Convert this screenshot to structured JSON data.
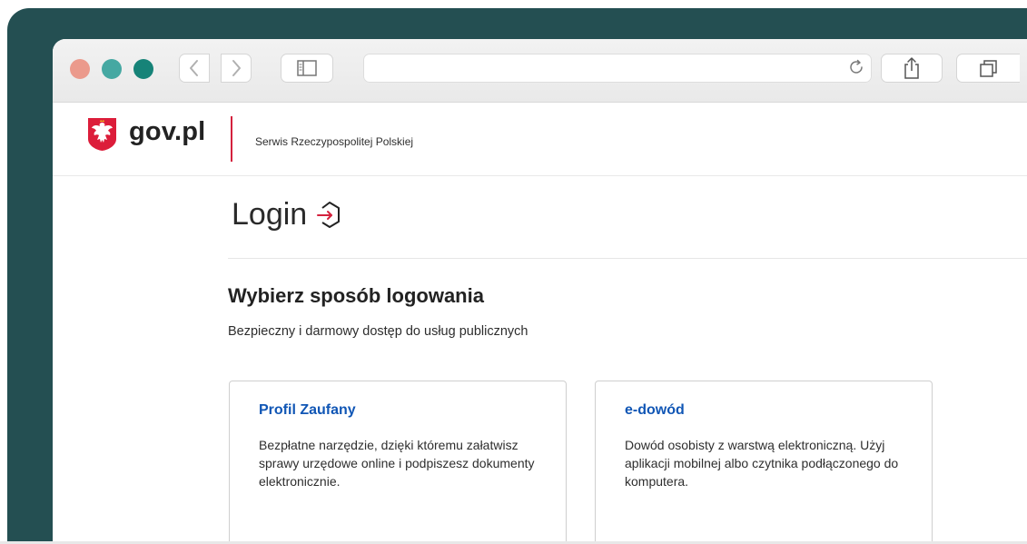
{
  "brand": {
    "name": "gov.pl",
    "service": "Serwis Rzeczypospolitej Polskiej",
    "emblem_icon": "polish-eagle-emblem-icon"
  },
  "browser": {
    "url": "",
    "icons": {
      "back": "chevron-left-icon",
      "forward": "chevron-right-icon",
      "sidebar": "sidebar-icon",
      "reload": "reload-icon",
      "share": "share-icon",
      "tabs": "tabs-icon"
    },
    "colors": {
      "traffic_close": "#eb9a8c",
      "traffic_minimize": "#45a8a2",
      "traffic_maximize": "#168378"
    }
  },
  "page": {
    "title": "Login",
    "title_icon": "login-icon",
    "heading": "Wybierz sposób logowania",
    "subheading": "Bezpieczny i darmowy dostęp do usług publicznych"
  },
  "options": [
    {
      "title": "Profil Zaufany",
      "description": "Bezpłatne narzędzie, dzięki któremu załatwisz sprawy urzędowe online i podpiszesz dokumenty elektronicznie."
    },
    {
      "title": "e-dowód",
      "description": "Dowód osobisty z warstwą elektroniczną. Użyj aplikacji mobilnej albo czytnika podłączonego do komputera."
    }
  ]
}
